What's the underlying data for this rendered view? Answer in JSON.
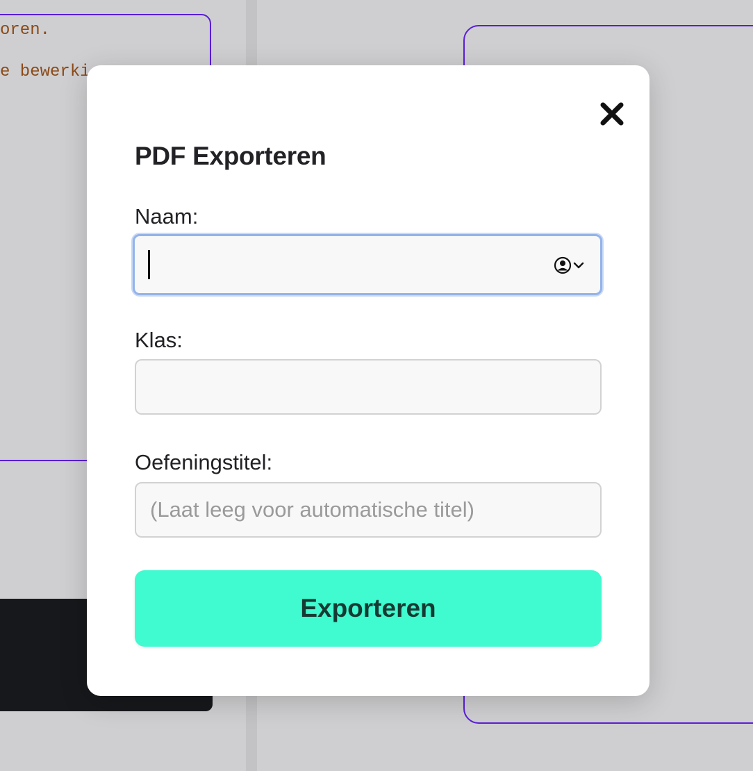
{
  "background": {
    "code_line_1": "oren.",
    "code_line_2": "e bewerki"
  },
  "modal": {
    "title": "PDF Exporteren",
    "close_icon": "close-x-icon",
    "fields": {
      "naam": {
        "label": "Naam:",
        "value": "",
        "autofill_icon": "contact-autofill-icon"
      },
      "klas": {
        "label": "Klas:",
        "value": ""
      },
      "oefeningstitel": {
        "label": "Oefeningstitel:",
        "placeholder": "(Laat leeg voor automatische titel)"
      }
    },
    "export_label": "Exporteren"
  },
  "colors": {
    "accent_button": "#40fad0",
    "panel_border": "#5a1ed6",
    "focus_ring": "#93b3ea"
  }
}
